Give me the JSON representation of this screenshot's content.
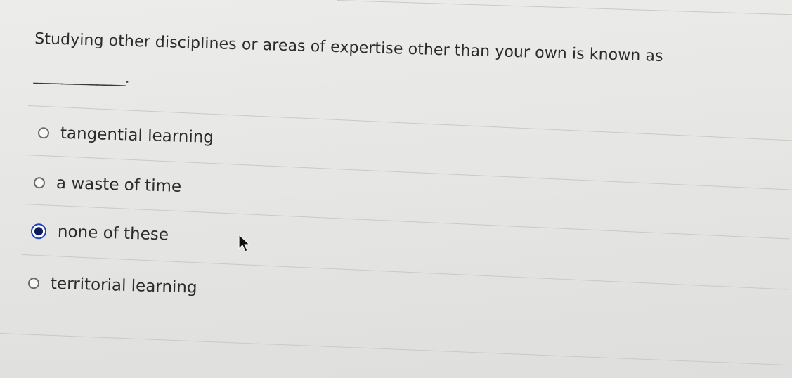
{
  "question": {
    "text": "Studying other disciplines or areas of expertise other than your own is known as",
    "blank": "_____________."
  },
  "options": [
    {
      "label": "tangential learning",
      "selected": false
    },
    {
      "label": "a waste of time",
      "selected": false
    },
    {
      "label": "none of these",
      "selected": true
    },
    {
      "label": "territorial learning",
      "selected": false
    }
  ],
  "icons": {
    "cursor": "arrow-cursor-icon"
  },
  "colors": {
    "selected_radio": "#1a3fc4"
  }
}
